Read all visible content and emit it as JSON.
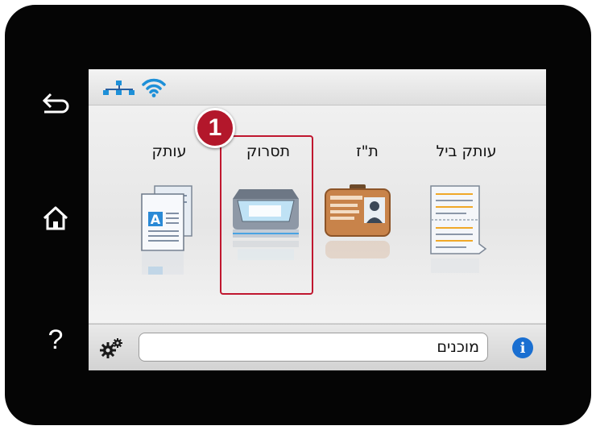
{
  "side_buttons": {
    "back_icon": "back-arrow-icon",
    "home_icon": "home-icon",
    "help_label": "?"
  },
  "status_bar": {
    "icons": [
      "network-icon",
      "wifi-icon"
    ]
  },
  "apps": [
    {
      "label": "עותק",
      "icon": "copy-icon"
    },
    {
      "label": "תסרוק",
      "icon": "scan-icon"
    },
    {
      "label": "ת\"ז",
      "icon": "id-card-icon"
    },
    {
      "label": "עותק ביל",
      "icon": "receipt-icon"
    }
  ],
  "step_badge": "1",
  "bottom_bar": {
    "status_text": "מוכנים",
    "settings_icon": "gears-icon",
    "info_icon": "info-icon"
  },
  "colors": {
    "highlight": "#c0172f",
    "info_blue": "#1a6fd1",
    "wifi_blue": "#1e90d8",
    "bezel": "#050505"
  }
}
